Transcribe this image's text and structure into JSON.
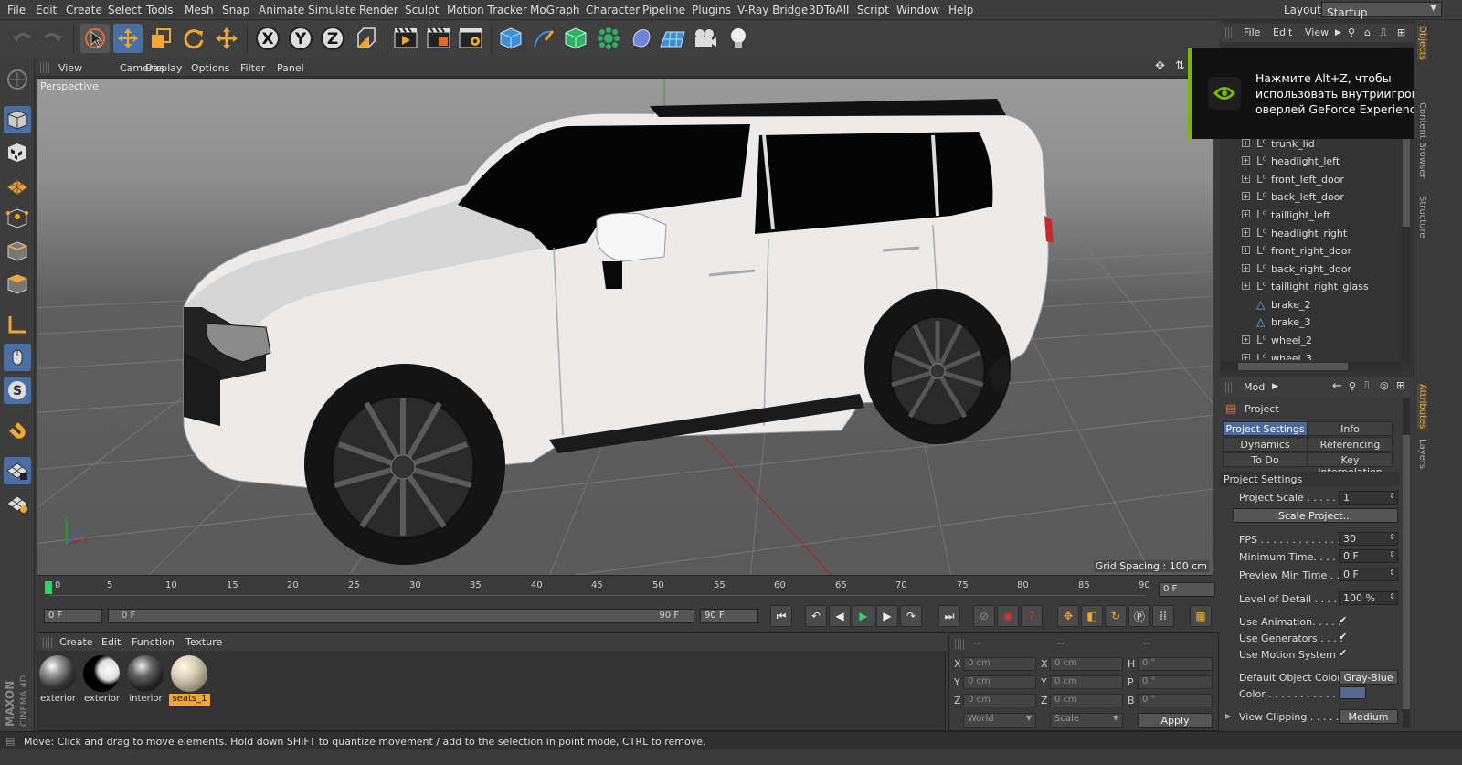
{
  "menubar": {
    "items": [
      "File",
      "Edit",
      "Create",
      "Select",
      "Tools",
      "Mesh",
      "Snap",
      "Animate",
      "Simulate",
      "Render",
      "Sculpt",
      "Motion Tracker",
      "MoGraph",
      "Character",
      "Pipeline",
      "Plugins",
      "V-Ray Bridge",
      "3DToAll",
      "Script",
      "Window",
      "Help"
    ],
    "layout_label": "Layout:",
    "layout_value": "Startup"
  },
  "viewport": {
    "menu": [
      "View",
      "Cameras",
      "Display",
      "Options",
      "Filter",
      "Panel"
    ],
    "camera_label": "Perspective",
    "grid_spacing": "Grid Spacing : 100 cm"
  },
  "timeline": {
    "ticks": [
      "0",
      "5",
      "10",
      "15",
      "20",
      "25",
      "30",
      "35",
      "40",
      "45",
      "50",
      "55",
      "60",
      "65",
      "70",
      "75",
      "80",
      "85",
      "90"
    ],
    "current_frame": "0 F",
    "start_frame": "0 F",
    "range_start": "0 F",
    "range_end": "90 F",
    "end_frame": "90 F"
  },
  "material_manager": {
    "menu": [
      "Create",
      "Edit",
      "Function",
      "Texture"
    ],
    "materials": [
      {
        "label": "exterior"
      },
      {
        "label": "exterior"
      },
      {
        "label": "interior"
      },
      {
        "label": "seats_1"
      }
    ]
  },
  "coordinates": {
    "header_a": "--",
    "header_b": "--",
    "header_c": "--",
    "rows": [
      {
        "a_label": "X",
        "a_val": "0 cm",
        "b_label": "X",
        "b_val": "0 cm",
        "c_label": "H",
        "c_val": "0 °"
      },
      {
        "a_label": "Y",
        "a_val": "0 cm",
        "b_label": "Y",
        "b_val": "0 cm",
        "c_label": "P",
        "c_val": "0 °"
      },
      {
        "a_label": "Z",
        "a_val": "0 cm",
        "b_label": "Z",
        "b_val": "0 cm",
        "c_label": "B",
        "c_val": "0 °"
      }
    ],
    "mode": "World",
    "transform": "Scale",
    "apply": "Apply"
  },
  "object_manager": {
    "menu": [
      "File",
      "Edit",
      "View"
    ],
    "objects": [
      "trunk_lid",
      "headlight_left",
      "front_left_door",
      "back_left_door",
      "taillight_left",
      "headlight_right",
      "front_right_door",
      "back_right_door",
      "taillight_right_glass",
      "brake_2",
      "brake_3",
      "wheel_2",
      "wheel_3"
    ]
  },
  "geforce_overlay": {
    "line1": "Нажмите Alt+Z, чтобы",
    "line2": "использовать внутриигровой",
    "line3": "оверлей GeForce Experience"
  },
  "attributes": {
    "mode_label": "Mod",
    "object_label": "Project",
    "tabs": [
      "Project Settings",
      "Info",
      "Dynamics",
      "Referencing",
      "To Do",
      "Key Interpolation"
    ],
    "section": "Project Settings",
    "project_scale_label": "Project Scale . . . . . .",
    "project_scale": "1",
    "scale_project_btn": "Scale Project...",
    "fps_label": "FPS . . . . . . . . . . . . .",
    "fps": "30",
    "min_time_label": "Minimum Time. . . . .",
    "min_time": "0 F",
    "preview_min_label": "Preview Min Time . .",
    "preview_min": "0 F",
    "lod_label": "Level of Detail . . . . .",
    "lod": "100 %",
    "use_anim_label": "Use Animation. . . . .",
    "use_gen_label": "Use Generators . . . .",
    "use_motion_label": "Use Motion System",
    "check": "✔",
    "def_color_label": "Default Object Color",
    "def_color": "Gray-Blue",
    "color_label": "Color . . . . . . . . . . .",
    "view_clip_label": "View Clipping . . . . .",
    "view_clip": "Medium"
  },
  "right_tabs": [
    "Objects",
    "Content Browser",
    "Structure",
    "Attributes",
    "Layers"
  ],
  "status": "Move: Click and drag to move elements. Hold down SHIFT to quantize movement / add to the selection in point mode, CTRL to remove.",
  "brand": {
    "line1": "MAXON",
    "line2": "CINEMA 4D"
  },
  "colors": {
    "accent": "#4c6a9c",
    "nvidia": "#76b900",
    "car_body": "#ecebea",
    "toolbar_active": "#4a6fa5"
  }
}
